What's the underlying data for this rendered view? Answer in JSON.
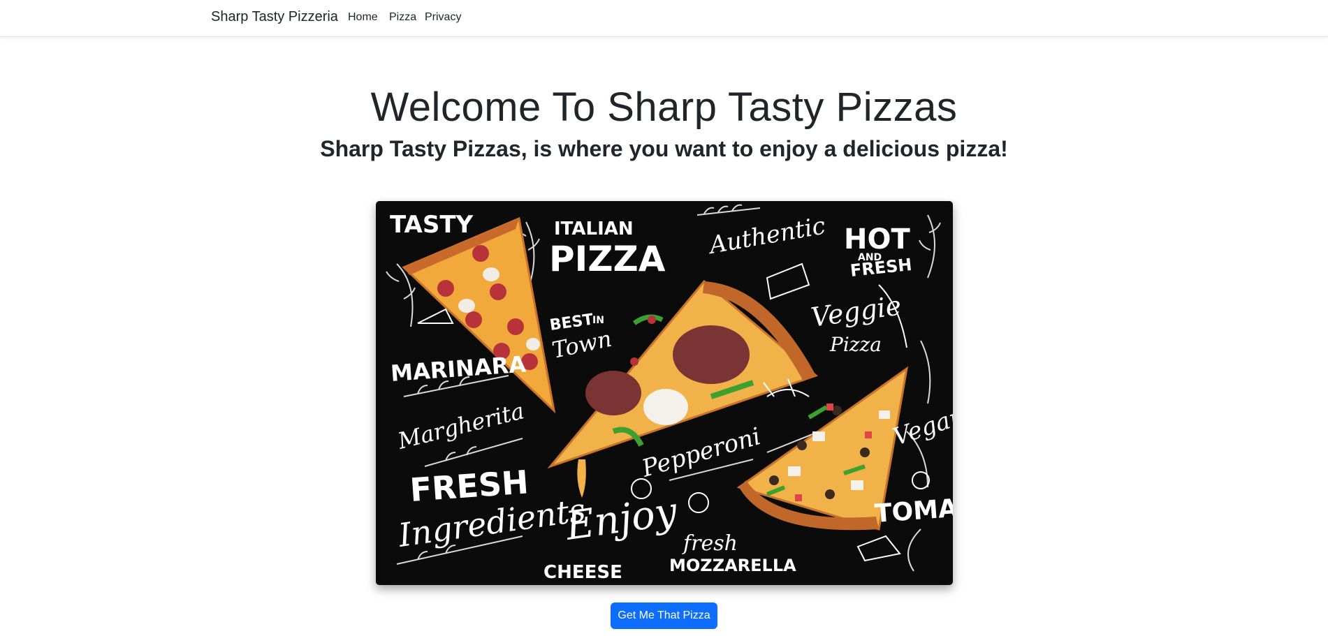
{
  "nav": {
    "brand": "Sharp Tasty Pizzeria",
    "links": [
      {
        "label": "Home"
      },
      {
        "label": "Pizza"
      },
      {
        "label": "Privacy"
      }
    ]
  },
  "hero": {
    "title": "Welcome To Sharp Tasty Pizzas",
    "subtitle": "Sharp Tasty Pizzas, is where you want to enjoy a delicious pizza!"
  },
  "board": {
    "words": {
      "tasty": "TASTY",
      "italian": "ITALIAN",
      "pizza": "PIZZA",
      "authentic": "Authentic",
      "hot": "HOT",
      "and": "AND",
      "fresh_hot": "FRESH",
      "best": "BEST",
      "in": "IN",
      "town": "Town",
      "veggie": "Veggie",
      "veggie_pizza": "Pizza",
      "marinara": "MARINARA",
      "margherita": "Margherita",
      "pepperoni": "Pepperoni",
      "vegan": "Vegan",
      "fresh_big": "FRESH",
      "ingredients": "Ingredients",
      "enjoy": "Enjoy",
      "tomato": "TOMATO",
      "fresh_small": "fresh",
      "mozzarella": "MOZZARELLA",
      "cheese": "CHEESE"
    }
  },
  "cta": {
    "label": "Get Me That Pizza"
  },
  "colors": {
    "primary": "#0d6efd",
    "board_bg": "#0b0b0b"
  }
}
